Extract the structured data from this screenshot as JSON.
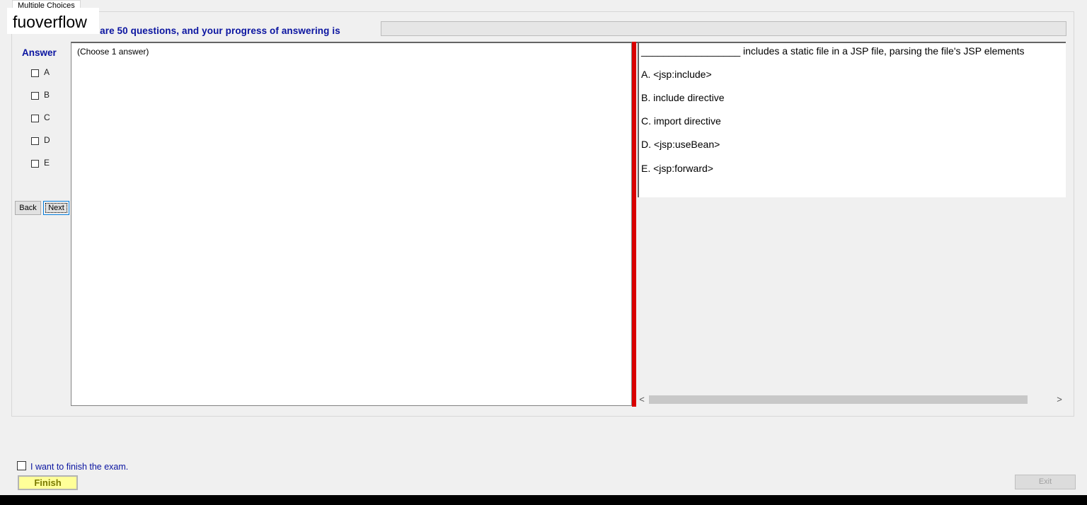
{
  "tab": {
    "label": "Multiple Choices"
  },
  "watermark": {
    "text": "fuoverflow"
  },
  "progress": {
    "text": "There are 50 questions, and your progress of answering is",
    "value": 0
  },
  "answer_panel": {
    "title": "Answer",
    "options": [
      "A",
      "B",
      "C",
      "D",
      "E"
    ]
  },
  "nav": {
    "back_label": "Back",
    "next_label": "Next"
  },
  "left_pane": {
    "instruction": "(Choose 1 answer)"
  },
  "question": {
    "stem": "__________________ includes a static file in a JSP file, parsing the file's JSP elements",
    "choices": [
      "A.  <jsp:include>",
      "B.  include directive",
      "C.  import directive",
      "D.  <jsp:useBean>",
      "E.  <jsp:forward>"
    ]
  },
  "scrollbar": {
    "left_arrow": "<",
    "right_arrow": ">"
  },
  "finish": {
    "checkbox_label": "I want to finish the exam.",
    "finish_label": "Finish",
    "exit_label": "Exit"
  },
  "colors": {
    "accent_blue": "#0a14a0",
    "splitter_red": "#d90000",
    "finish_yellow": "#ffff99"
  }
}
